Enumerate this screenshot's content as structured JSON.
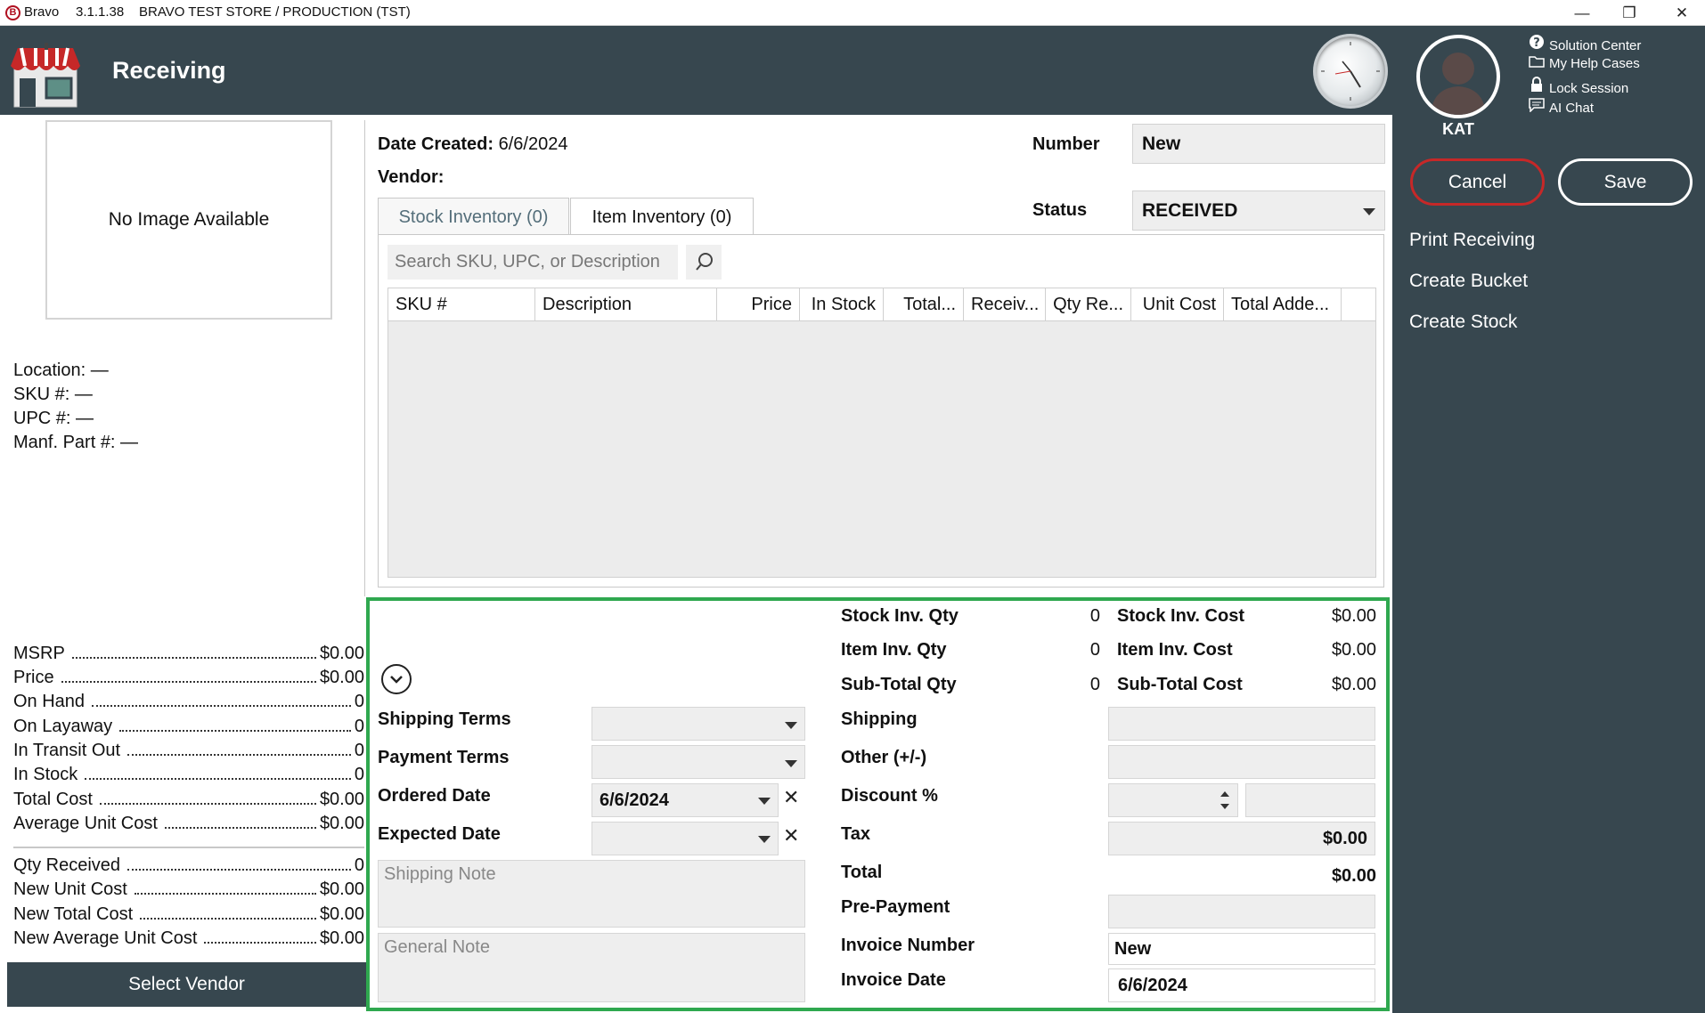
{
  "window": {
    "app_name": "Bravo",
    "version": "3.1.1.38",
    "store": "BRAVO TEST STORE / PRODUCTION (TST)",
    "minimize": "—",
    "maximize": "❐",
    "close": "✕"
  },
  "header": {
    "title": "Receiving"
  },
  "user": {
    "name": "KAT"
  },
  "help_links": [
    {
      "label": "Solution Center",
      "icon": "question-icon"
    },
    {
      "label": "My Help Cases",
      "icon": "folder-icon"
    },
    {
      "label": "Lock Session",
      "icon": "lock-icon"
    },
    {
      "label": "AI Chat",
      "icon": "chat-icon"
    }
  ],
  "actions": {
    "cancel": "Cancel",
    "save": "Save",
    "print_receiving": "Print Receiving",
    "create_bucket": "Create Bucket",
    "create_stock": "Create Stock"
  },
  "left": {
    "no_image": "No Image Available",
    "location": "Location: —",
    "sku": "SKU #: —",
    "upc": "UPC #: —",
    "manf_part": "Manf. Part #: —",
    "stats": [
      {
        "label": "MSRP",
        "value": "$0.00"
      },
      {
        "label": "Price",
        "value": "$0.00"
      },
      {
        "label": "On Hand",
        "value": "0"
      },
      {
        "label": "On Layaway",
        "value": "0"
      },
      {
        "label": "In Transit Out",
        "value": "0"
      },
      {
        "label": "In Stock",
        "value": "0"
      },
      {
        "label": "Total Cost",
        "value": "$0.00"
      },
      {
        "label": "Average Unit Cost",
        "value": "$0.00"
      }
    ],
    "received_stats": [
      {
        "label": "Qty Received",
        "value": "0"
      },
      {
        "label": "New Unit Cost",
        "value": "$0.00"
      },
      {
        "label": "New Total Cost",
        "value": "$0.00"
      },
      {
        "label": "New Average Unit Cost",
        "value": "$0.00"
      }
    ],
    "select_vendor": "Select Vendor"
  },
  "form": {
    "date_created_label": "Date Created:",
    "date_created_value": "6/6/2024",
    "vendor_label": "Vendor:",
    "number_label": "Number",
    "number_value": "New",
    "status_label": "Status",
    "status_value": "RECEIVED"
  },
  "tabs": [
    {
      "label": "Stock Inventory (0)",
      "active": true
    },
    {
      "label": "Item Inventory (0)",
      "active": false
    }
  ],
  "search": {
    "placeholder": "Search SKU, UPC, or Description"
  },
  "grid": {
    "columns": [
      "SKU #",
      "Description",
      "Price",
      "In Stock",
      "Total...",
      "Receiv...",
      "Qty Re...",
      "Unit Cost",
      "Total Adde..."
    ],
    "rows": []
  },
  "summary": {
    "stock_inv_qty_label": "Stock Inv. Qty",
    "stock_inv_qty": "0",
    "item_inv_qty_label": "Item Inv. Qty",
    "item_inv_qty": "0",
    "subtotal_qty_label": "Sub-Total Qty",
    "subtotal_qty": "0",
    "stock_inv_cost_label": "Stock Inv. Cost",
    "stock_inv_cost": "$0.00",
    "item_inv_cost_label": "Item Inv. Cost",
    "item_inv_cost": "$0.00",
    "subtotal_cost_label": "Sub-Total Cost",
    "subtotal_cost": "$0.00",
    "shipping_terms_label": "Shipping Terms",
    "shipping_terms": "",
    "payment_terms_label": "Payment Terms",
    "payment_terms": "",
    "ordered_date_label": "Ordered Date",
    "ordered_date": "6/6/2024",
    "expected_date_label": "Expected Date",
    "expected_date": "",
    "shipping_note_placeholder": "Shipping Note",
    "general_note_placeholder": "General Note",
    "shipping_label": "Shipping",
    "shipping": "",
    "other_label": "Other (+/-)",
    "other": "",
    "discount_label": "Discount %",
    "discount_pct": "",
    "discount_amount": "",
    "tax_label": "Tax",
    "tax": "$0.00",
    "total_label": "Total",
    "total": "$0.00",
    "prepayment_label": "Pre-Payment",
    "prepayment": "",
    "invoice_number_label": "Invoice Number",
    "invoice_number": "New",
    "invoice_date_label": "Invoice Date",
    "invoice_date": "6/6/2024"
  },
  "colors": {
    "header_bg": "#37474f",
    "highlight": "#2fa84f",
    "cancel_border": "#c62828"
  }
}
